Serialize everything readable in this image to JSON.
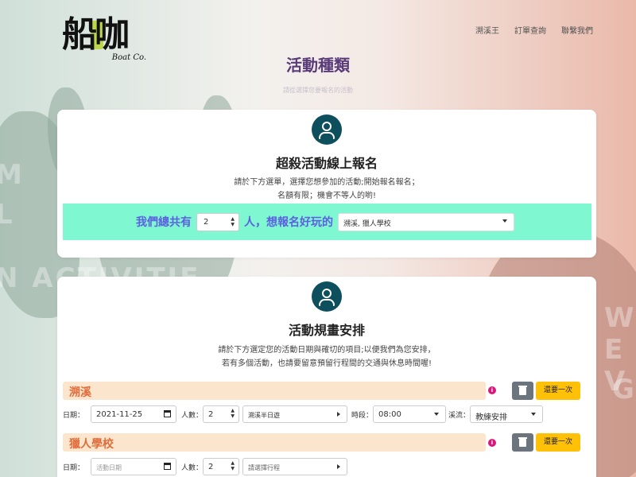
{
  "logo": {
    "main": "船咖",
    "sub": "Boat Co."
  },
  "nav": [
    "溯溪王",
    "訂單查詢",
    "聯繫我們"
  ],
  "page": {
    "title": "活動種類",
    "subtitle": "請從選擇您要報名的活動"
  },
  "signup": {
    "title": "超殺活動線上報名",
    "desc_line1": "請於下方選單，選擇您想參加的活動;開始報名報名；",
    "desc_line2": "名額有限；機會不等人的喲!",
    "prefix": "我們總共有",
    "count": "2",
    "suffix": "人，想報名好玩的",
    "activities": "溯溪, 獵人學校"
  },
  "plan": {
    "title": "活動規畫安排",
    "desc_line1": "請於下方選定您的活動日期與確切的項目;以便我們為您安排，",
    "desc_line2": "若有多個活動，也請要留意預留行程間的交通與休息時間喔!",
    "again_label": "還要一次",
    "sections": [
      {
        "name": "溯溪",
        "date_label": "日期：",
        "date_value": "2021-11-25",
        "people_label": "人數：",
        "people_value": "2",
        "trip": "溯溪半日遊",
        "time_label": "時段：",
        "time_value": "08:00",
        "stream_label": "溪流：",
        "stream_value": "教練安排"
      },
      {
        "name": "獵人學校",
        "date_label": "日期：",
        "date_placeholder": "活動日期",
        "people_label": "人數：",
        "people_value": "2",
        "trip_placeholder": "請選擇行程"
      }
    ]
  },
  "colors": {
    "accent_purple": "#5a3b7a",
    "green_bar": "#7ff7d0",
    "orange_title": "#e06d3b",
    "yellow_btn": "#ffc107"
  }
}
